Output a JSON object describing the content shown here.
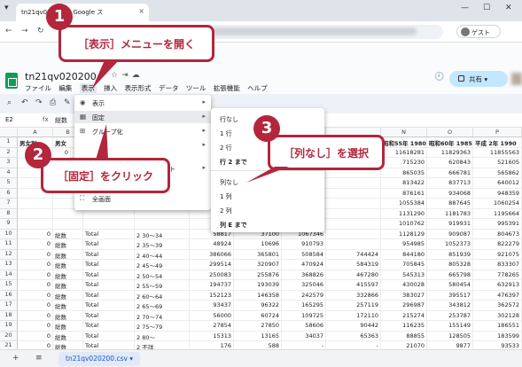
{
  "browser": {
    "tab_title": "tn21qv020200 - Google ス",
    "guest_label": "ゲスト"
  },
  "doc": {
    "title": "tn21qv020200",
    "menu": [
      "ファイル",
      "編集",
      "表示",
      "挿入",
      "表示形式",
      "データ",
      "ツール",
      "拡張機能",
      "ヘルプ"
    ],
    "share_label": "共有"
  },
  "formula_bar": {
    "cell_ref": "E2",
    "fx": "fx",
    "value": "総数"
  },
  "grid": {
    "columns": [
      "",
      "A",
      "B",
      "C",
      "D",
      "",
      "",
      "",
      "",
      "N",
      "O",
      "P"
    ],
    "header_row": [
      "男女別",
      "男女",
      "",
      "",
      "",
      "",
      "",
      "",
      "昭和55年 1980",
      "昭和60年 1985",
      "平成 2年 1990"
    ],
    "rows": [
      {
        "n": "2",
        "a": "",
        "b": "",
        "c": "",
        "d": "",
        "e": "",
        "f": "",
        "g": "",
        "h": "",
        "n1": "11618281",
        "o": "11829363",
        "p": "11855563"
      },
      {
        "n": "3",
        "a": "",
        "b": "",
        "c": "",
        "d": "",
        "e": "",
        "f": "",
        "g": "",
        "h": "",
        "n1": "715230",
        "o": "620843",
        "p": "521605"
      },
      {
        "n": "4",
        "a": "",
        "b": "",
        "c": "",
        "d": "",
        "e": "",
        "f": "",
        "g": "",
        "h": "",
        "n1": "865035",
        "o": "666781",
        "p": "565862"
      },
      {
        "n": "5",
        "a": "",
        "b": "",
        "c": "",
        "d": "",
        "e": "",
        "f": "",
        "g": "",
        "h": "",
        "n1": "813422",
        "o": "837713",
        "p": "640012"
      },
      {
        "n": "6",
        "a": "",
        "b": "",
        "c": "",
        "d": "",
        "e": "",
        "f": "37069",
        "g": "743050",
        "h": "",
        "n1": "876161",
        "o": "934068",
        "p": "948359"
      },
      {
        "n": "7",
        "a": "",
        "b": "",
        "c": "",
        "d": "",
        "e": "",
        "f": "13755",
        "g": "824026",
        "h": "",
        "n1": "1055384",
        "o": "887645",
        "p": "1060254"
      },
      {
        "n": "8",
        "a": "",
        "b": "",
        "c": "",
        "d": "",
        "e": "",
        "f": "75115",
        "g": "1311354",
        "h": "",
        "n1": "1131290",
        "o": "1181783",
        "p": "1195664"
      },
      {
        "n": "9",
        "a": "",
        "b": "",
        "c": "",
        "d": "",
        "e": "",
        "f": "10878",
        "g": "1338307",
        "h": "",
        "n1": "1010762",
        "o": "919931",
        "p": "995391"
      },
      {
        "n": "10",
        "a": "0",
        "b": "総数",
        "c": "Total",
        "d": "2 30～34",
        "e": "58817",
        "f": "37100",
        "g": "1067346",
        "h": "",
        "n1": "1128129",
        "o": "909087",
        "p": "804673"
      },
      {
        "n": "11",
        "a": "0",
        "b": "総数",
        "c": "Total",
        "d": "2 35～39",
        "e": "48924",
        "f": "10696",
        "g": "910793",
        "h": "",
        "n1": "954985",
        "o": "1052373",
        "p": "822279"
      },
      {
        "n": "12",
        "a": "0",
        "b": "総数",
        "c": "Total",
        "d": "2 40～44",
        "e": "386066",
        "f": "365801",
        "g": "508584",
        "h": "744424",
        "n1": "844180",
        "o": "851939",
        "p": "921075",
        "q": "1000011"
      },
      {
        "n": "13",
        "a": "0",
        "b": "総数",
        "c": "Total",
        "d": "2 45～49",
        "e": "299514",
        "f": "320907",
        "g": "470924",
        "h": "584319",
        "n1": "705845",
        "o": "805328",
        "p": "833307",
        "q": "893591"
      },
      {
        "n": "14",
        "a": "0",
        "b": "総数",
        "c": "Total",
        "d": "2 50～54",
        "e": "250083",
        "f": "255876",
        "g": "368826",
        "h": "467280",
        "n1": "545313",
        "o": "665798",
        "p": "778265",
        "q": "864002"
      },
      {
        "n": "15",
        "a": "0",
        "b": "総数",
        "c": "Total",
        "d": "2 55～59",
        "e": "194737",
        "f": "193039",
        "g": "325046",
        "h": "415597",
        "n1": "430028",
        "o": "580454",
        "p": "632913",
        "q": "737990"
      },
      {
        "n": "16",
        "a": "0",
        "b": "総数",
        "c": "Total",
        "d": "2 60～64",
        "e": "152123",
        "f": "146358",
        "g": "242579",
        "h": "332866",
        "n1": "383027",
        "o": "395517",
        "p": "476397",
        "q": "588445"
      },
      {
        "n": "17",
        "a": "0",
        "b": "総数",
        "c": "Total",
        "d": "2 65～69",
        "e": "93437",
        "f": "96322",
        "g": "165295",
        "h": "257119",
        "n1": "296987",
        "o": "343812",
        "p": "362572",
        "q": "433965"
      },
      {
        "n": "18",
        "a": "0",
        "b": "総数",
        "c": "Total",
        "d": "2 70～74",
        "e": "56000",
        "f": "60724",
        "g": "109725",
        "h": "172110",
        "n1": "215274",
        "o": "253787",
        "p": "302128",
        "q": "318591"
      },
      {
        "n": "19",
        "a": "0",
        "b": "総数",
        "c": "Total",
        "d": "2 75～79",
        "e": "27854",
        "f": "27850",
        "g": "58606",
        "h": "90442",
        "n1": "116235",
        "o": "155149",
        "p": "186551",
        "q": "218253"
      },
      {
        "n": "20",
        "a": "0",
        "b": "総数",
        "c": "Total",
        "d": "2 80～",
        "e": "15313",
        "f": "13165",
        "g": "34037",
        "h": "65363",
        "n1": "88855",
        "o": "128505",
        "p": "183599",
        "q": "242255"
      },
      {
        "n": "21",
        "a": "0",
        "b": "総数",
        "c": "Total",
        "d": "2 不詳",
        "e": "176",
        "f": "588",
        "g": "-",
        "h": "-",
        "n1": "21070",
        "o": "9877",
        "p": "93533",
        "q": ""
      },
      {
        "n": "22",
        "a": "0",
        "b": "総数",
        "c": "Total",
        "d": "1 (再掲)0～14",
        "e": "2314871",
        "f": "1987978",
        "g": "2249052",
        "h": "2400630",
        "n1": "2564449",
        "o": "2393687",
        "p": "2125337",
        "q": "1727479"
      },
      {
        "n": "23",
        "a": "0",
        "b": "総数",
        "c": "Total",
        "d": "1 (再掲)15～64",
        "e": "4839332",
        "f": "4090873",
        "g": "7067087",
        "h": "8416630",
        "n1": "8360219",
        "o": "8308563",
        "p": "8638299",
        "q": "8790525"
      }
    ],
    "partial_cells": {
      "r1a": "1",
      "r1b": "0",
      "r1c": "総数",
      "r2a": "0",
      "r2b": "総数"
    }
  },
  "view_menu": {
    "items": [
      {
        "label": "表示",
        "icon": "eye-icon"
      },
      {
        "label": "固定",
        "icon": "freeze-icon"
      },
      {
        "label": "グループ化",
        "icon": "group-icon"
      },
      {
        "label": "",
        "icon": ""
      },
      {
        "label": "全画面",
        "icon": "fullscreen-icon"
      }
    ],
    "partial_item": "ート"
  },
  "freeze_submenu": {
    "items": [
      "行なし",
      "1 行",
      "2 行",
      "行 2 まで",
      "列なし",
      "1 列",
      "2 列",
      "列 E まで"
    ]
  },
  "callouts": [
    {
      "num": "1",
      "text": "［表示］メニューを開く"
    },
    {
      "num": "2",
      "text": "［固定］をクリック"
    },
    {
      "num": "3",
      "text": "［列なし］を選択"
    }
  ],
  "sheet_tab": "tn21qv020200.csv",
  "colors": {
    "accent": "#b3263b",
    "sheets_green": "#0f9d58",
    "share_blue": "#c2e7ff"
  }
}
